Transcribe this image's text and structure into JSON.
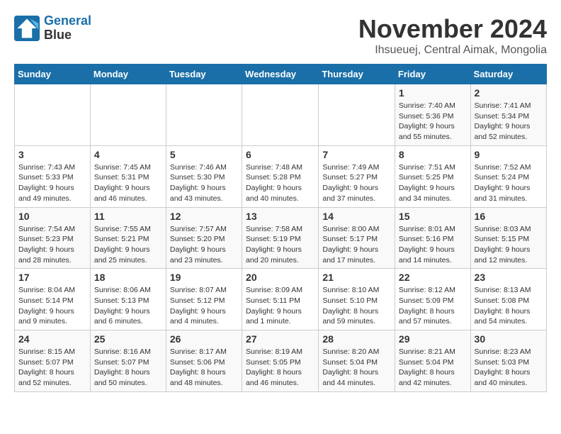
{
  "logo": {
    "line1": "General",
    "line2": "Blue"
  },
  "title": "November 2024",
  "location": "Ihsueuej, Central Aimak, Mongolia",
  "days_of_week": [
    "Sunday",
    "Monday",
    "Tuesday",
    "Wednesday",
    "Thursday",
    "Friday",
    "Saturday"
  ],
  "weeks": [
    [
      {
        "day": "",
        "info": ""
      },
      {
        "day": "",
        "info": ""
      },
      {
        "day": "",
        "info": ""
      },
      {
        "day": "",
        "info": ""
      },
      {
        "day": "",
        "info": ""
      },
      {
        "day": "1",
        "info": "Sunrise: 7:40 AM\nSunset: 5:36 PM\nDaylight: 9 hours\nand 55 minutes."
      },
      {
        "day": "2",
        "info": "Sunrise: 7:41 AM\nSunset: 5:34 PM\nDaylight: 9 hours\nand 52 minutes."
      }
    ],
    [
      {
        "day": "3",
        "info": "Sunrise: 7:43 AM\nSunset: 5:33 PM\nDaylight: 9 hours\nand 49 minutes."
      },
      {
        "day": "4",
        "info": "Sunrise: 7:45 AM\nSunset: 5:31 PM\nDaylight: 9 hours\nand 46 minutes."
      },
      {
        "day": "5",
        "info": "Sunrise: 7:46 AM\nSunset: 5:30 PM\nDaylight: 9 hours\nand 43 minutes."
      },
      {
        "day": "6",
        "info": "Sunrise: 7:48 AM\nSunset: 5:28 PM\nDaylight: 9 hours\nand 40 minutes."
      },
      {
        "day": "7",
        "info": "Sunrise: 7:49 AM\nSunset: 5:27 PM\nDaylight: 9 hours\nand 37 minutes."
      },
      {
        "day": "8",
        "info": "Sunrise: 7:51 AM\nSunset: 5:25 PM\nDaylight: 9 hours\nand 34 minutes."
      },
      {
        "day": "9",
        "info": "Sunrise: 7:52 AM\nSunset: 5:24 PM\nDaylight: 9 hours\nand 31 minutes."
      }
    ],
    [
      {
        "day": "10",
        "info": "Sunrise: 7:54 AM\nSunset: 5:23 PM\nDaylight: 9 hours\nand 28 minutes."
      },
      {
        "day": "11",
        "info": "Sunrise: 7:55 AM\nSunset: 5:21 PM\nDaylight: 9 hours\nand 25 minutes."
      },
      {
        "day": "12",
        "info": "Sunrise: 7:57 AM\nSunset: 5:20 PM\nDaylight: 9 hours\nand 23 minutes."
      },
      {
        "day": "13",
        "info": "Sunrise: 7:58 AM\nSunset: 5:19 PM\nDaylight: 9 hours\nand 20 minutes."
      },
      {
        "day": "14",
        "info": "Sunrise: 8:00 AM\nSunset: 5:17 PM\nDaylight: 9 hours\nand 17 minutes."
      },
      {
        "day": "15",
        "info": "Sunrise: 8:01 AM\nSunset: 5:16 PM\nDaylight: 9 hours\nand 14 minutes."
      },
      {
        "day": "16",
        "info": "Sunrise: 8:03 AM\nSunset: 5:15 PM\nDaylight: 9 hours\nand 12 minutes."
      }
    ],
    [
      {
        "day": "17",
        "info": "Sunrise: 8:04 AM\nSunset: 5:14 PM\nDaylight: 9 hours\nand 9 minutes."
      },
      {
        "day": "18",
        "info": "Sunrise: 8:06 AM\nSunset: 5:13 PM\nDaylight: 9 hours\nand 6 minutes."
      },
      {
        "day": "19",
        "info": "Sunrise: 8:07 AM\nSunset: 5:12 PM\nDaylight: 9 hours\nand 4 minutes."
      },
      {
        "day": "20",
        "info": "Sunrise: 8:09 AM\nSunset: 5:11 PM\nDaylight: 9 hours\nand 1 minute."
      },
      {
        "day": "21",
        "info": "Sunrise: 8:10 AM\nSunset: 5:10 PM\nDaylight: 8 hours\nand 59 minutes."
      },
      {
        "day": "22",
        "info": "Sunrise: 8:12 AM\nSunset: 5:09 PM\nDaylight: 8 hours\nand 57 minutes."
      },
      {
        "day": "23",
        "info": "Sunrise: 8:13 AM\nSunset: 5:08 PM\nDaylight: 8 hours\nand 54 minutes."
      }
    ],
    [
      {
        "day": "24",
        "info": "Sunrise: 8:15 AM\nSunset: 5:07 PM\nDaylight: 8 hours\nand 52 minutes."
      },
      {
        "day": "25",
        "info": "Sunrise: 8:16 AM\nSunset: 5:07 PM\nDaylight: 8 hours\nand 50 minutes."
      },
      {
        "day": "26",
        "info": "Sunrise: 8:17 AM\nSunset: 5:06 PM\nDaylight: 8 hours\nand 48 minutes."
      },
      {
        "day": "27",
        "info": "Sunrise: 8:19 AM\nSunset: 5:05 PM\nDaylight: 8 hours\nand 46 minutes."
      },
      {
        "day": "28",
        "info": "Sunrise: 8:20 AM\nSunset: 5:04 PM\nDaylight: 8 hours\nand 44 minutes."
      },
      {
        "day": "29",
        "info": "Sunrise: 8:21 AM\nSunset: 5:04 PM\nDaylight: 8 hours\nand 42 minutes."
      },
      {
        "day": "30",
        "info": "Sunrise: 8:23 AM\nSunset: 5:03 PM\nDaylight: 8 hours\nand 40 minutes."
      }
    ]
  ]
}
